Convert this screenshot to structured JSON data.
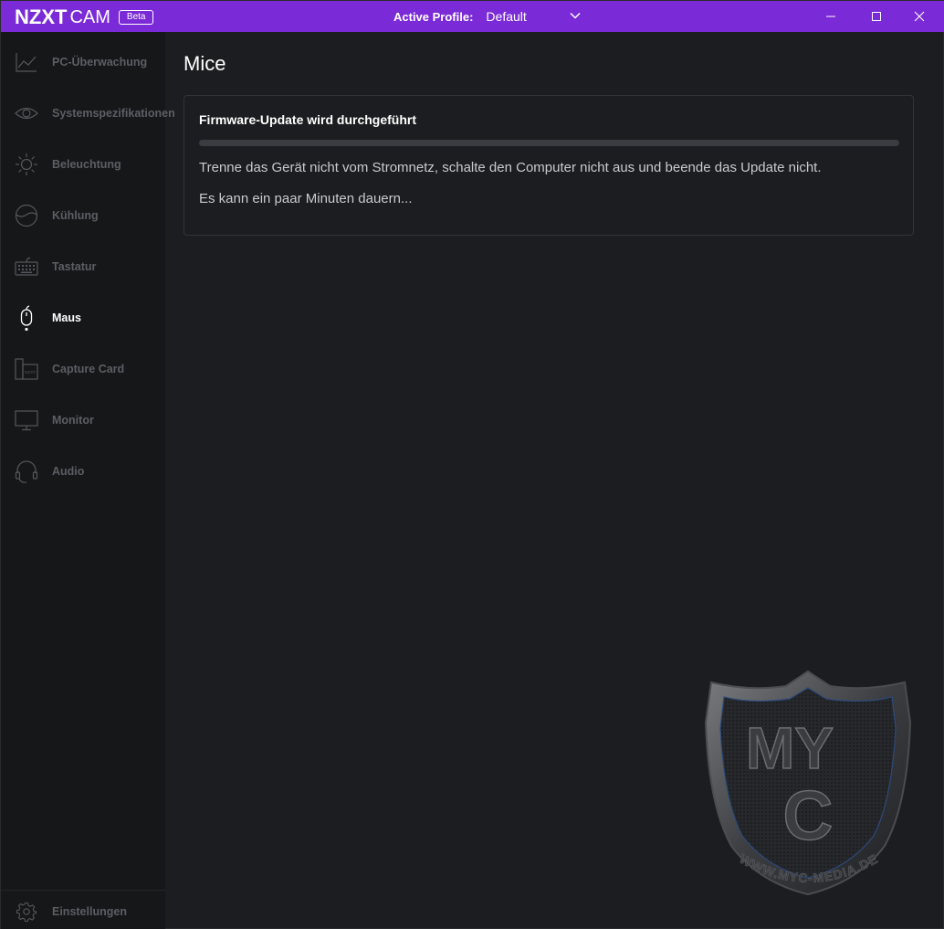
{
  "titlebar": {
    "logo_text": "NZXT",
    "app_name": "CAM",
    "badge": "Beta",
    "profile_label": "Active Profile:",
    "profile_value": "Default",
    "icons": [
      "minimize-icon",
      "maximize-icon",
      "close-icon"
    ]
  },
  "sidebar": {
    "items": [
      {
        "label": "PC-Überwachung",
        "icon": "chart-line-icon",
        "active": false
      },
      {
        "label": "Systemspezifikationen",
        "icon": "eye-icon",
        "active": false
      },
      {
        "label": "Beleuchtung",
        "icon": "sun-icon",
        "active": false
      },
      {
        "label": "Kühlung",
        "icon": "cooling-icon",
        "active": false
      },
      {
        "label": "Tastatur",
        "icon": "keyboard-icon",
        "active": false
      },
      {
        "label": "Maus",
        "icon": "mouse-icon",
        "active": true
      },
      {
        "label": "Capture Card",
        "icon": "capture-card-icon",
        "active": false
      },
      {
        "label": "Monitor",
        "icon": "monitor-icon",
        "active": false
      },
      {
        "label": "Audio",
        "icon": "headset-icon",
        "active": false
      }
    ],
    "settings_label": "Einstellungen"
  },
  "main": {
    "title": "Mice",
    "card": {
      "title": "Firmware-Update wird durchgeführt",
      "progress": 0,
      "message": "Trenne das Gerät nicht vom Stromnetz, schalte den Computer nicht aus und beende das Update nicht.",
      "note": "Es kann ein paar Minuten dauern..."
    }
  },
  "watermark": {
    "text": "WWW.MYC-MEDIA.DE",
    "letters_top": "MY",
    "letter_bottom": "C"
  },
  "colors": {
    "accent": "#7a2ad6",
    "background": "#1c1d20",
    "sidebar": "#161719",
    "inactive_text": "#5c5e64"
  }
}
